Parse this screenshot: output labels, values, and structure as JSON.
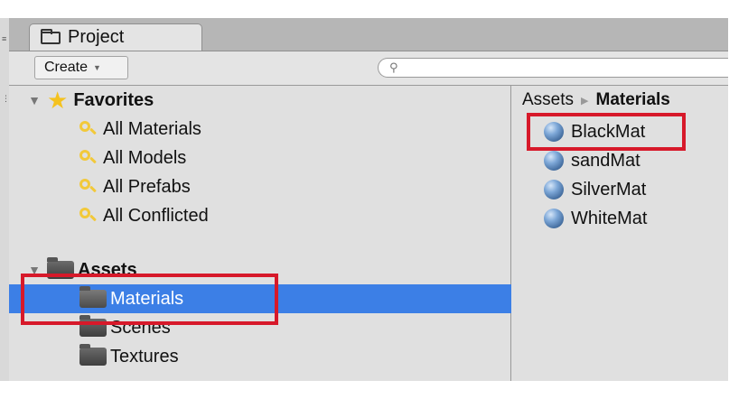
{
  "window": {
    "tab_title": "Project"
  },
  "toolbar": {
    "create_label": "Create",
    "search_placeholder": ""
  },
  "tree": {
    "favorites_label": "Favorites",
    "favorites": [
      "All Materials",
      "All Models",
      "All Prefabs",
      "All Conflicted"
    ],
    "assets_label": "Assets",
    "folders": [
      "Materials",
      "Scenes",
      "Textures"
    ],
    "selected_folder": "Materials"
  },
  "breadcrumb": {
    "root": "Assets",
    "current": "Materials"
  },
  "materials": [
    "BlackMat",
    "sandMat",
    "SilverMat",
    "WhiteMat"
  ],
  "colors": {
    "selection": "#3c7fe6",
    "highlight": "#d7192a",
    "star": "#f4c21f"
  }
}
